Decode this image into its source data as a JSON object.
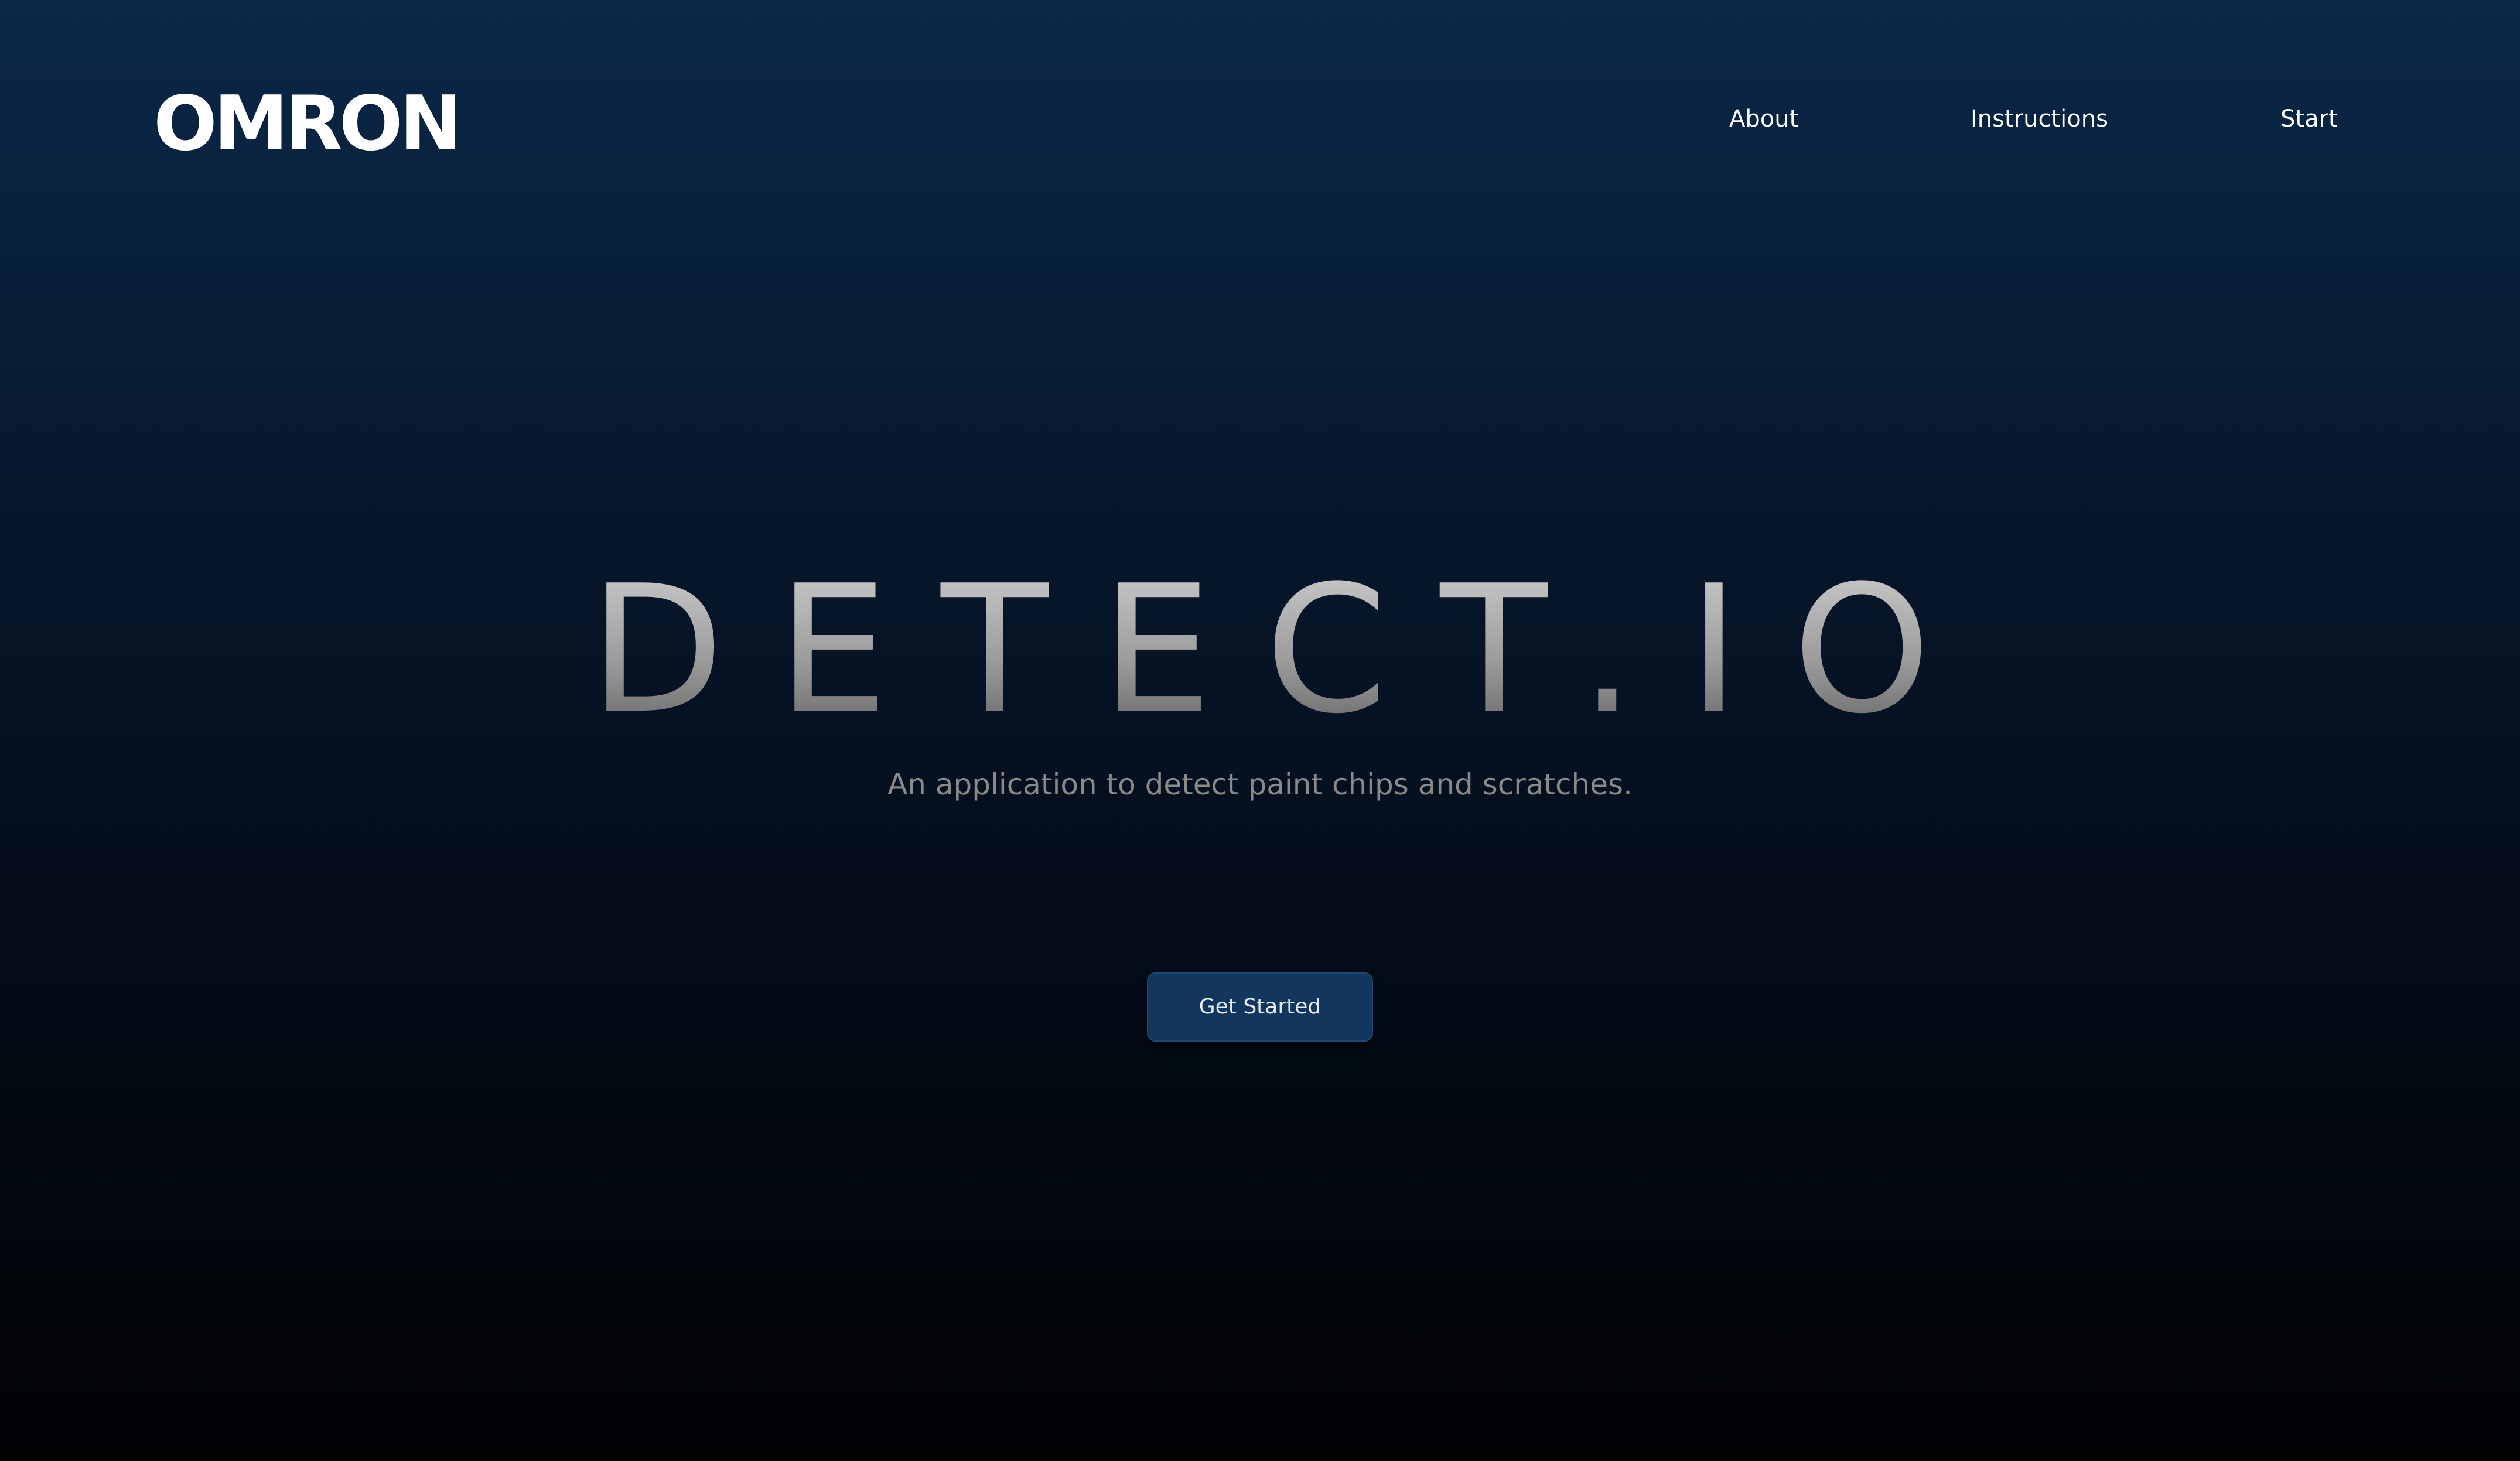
{
  "header": {
    "logo_text": "OMRON",
    "nav": [
      {
        "label": "About"
      },
      {
        "label": "Instructions"
      },
      {
        "label": "Start"
      }
    ]
  },
  "hero": {
    "title": "DETECT.IO",
    "subtitle": "An application to detect paint chips and scratches.",
    "cta_label": "Get Started"
  }
}
